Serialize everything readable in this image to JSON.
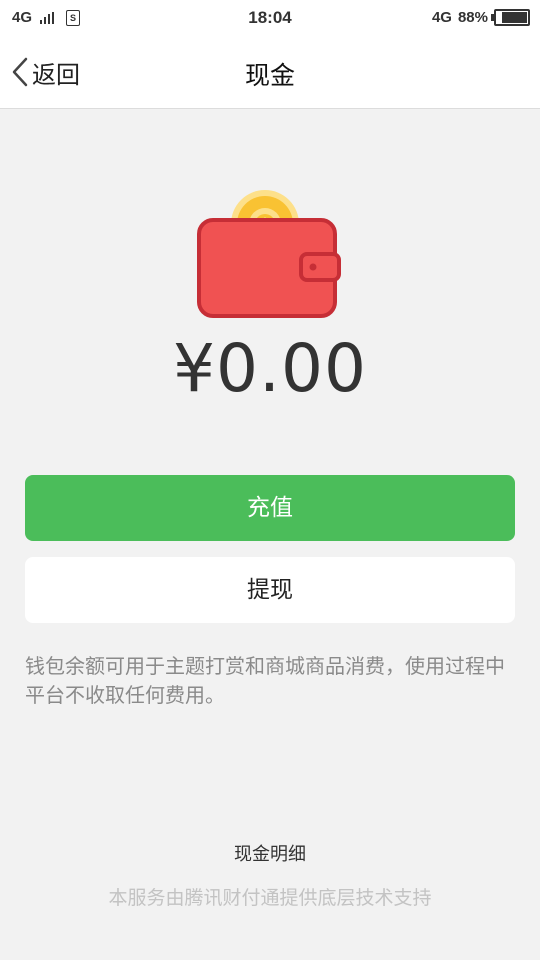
{
  "status_bar": {
    "network_left": "4G",
    "sim_label": "S",
    "time": "18:04",
    "network_right": "4G",
    "battery_percent": "88%",
    "battery_level": 0.88
  },
  "nav": {
    "back_label": "返回",
    "title": "现金"
  },
  "wallet": {
    "amount": "¥0.00",
    "icon": "wallet-with-coin-icon",
    "colors": {
      "wallet": "#f05252",
      "coin": "#f9c233"
    }
  },
  "actions": {
    "recharge_label": "充值",
    "withdraw_label": "提现",
    "accent": "#4bbd5a"
  },
  "note": "钱包余额可用于主题打赏和商城商品消费，使用过程中平台不收取任何费用。",
  "details_link": "现金明细",
  "footer": "本服务由腾讯财付通提供底层技术支持"
}
